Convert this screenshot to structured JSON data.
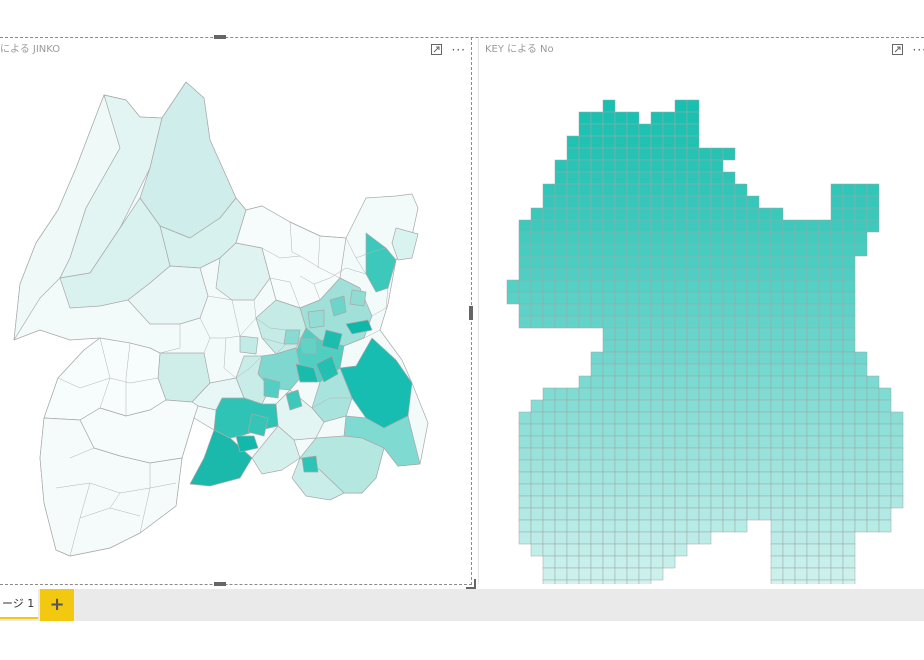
{
  "visuals": {
    "left": {
      "title": "による JINKO"
    },
    "right": {
      "title": "KEY による No"
    }
  },
  "icons": {
    "focus": "focus-mode-icon",
    "more": "more-options-icon",
    "add": "plus-icon"
  },
  "tabs": {
    "active_label": "ージ 1",
    "add_label": "+"
  },
  "colors": {
    "accent": "#1abfb0",
    "light": "#f3fbfa",
    "border": "#9a9a9a",
    "tab_accent": "#f2c811"
  }
}
